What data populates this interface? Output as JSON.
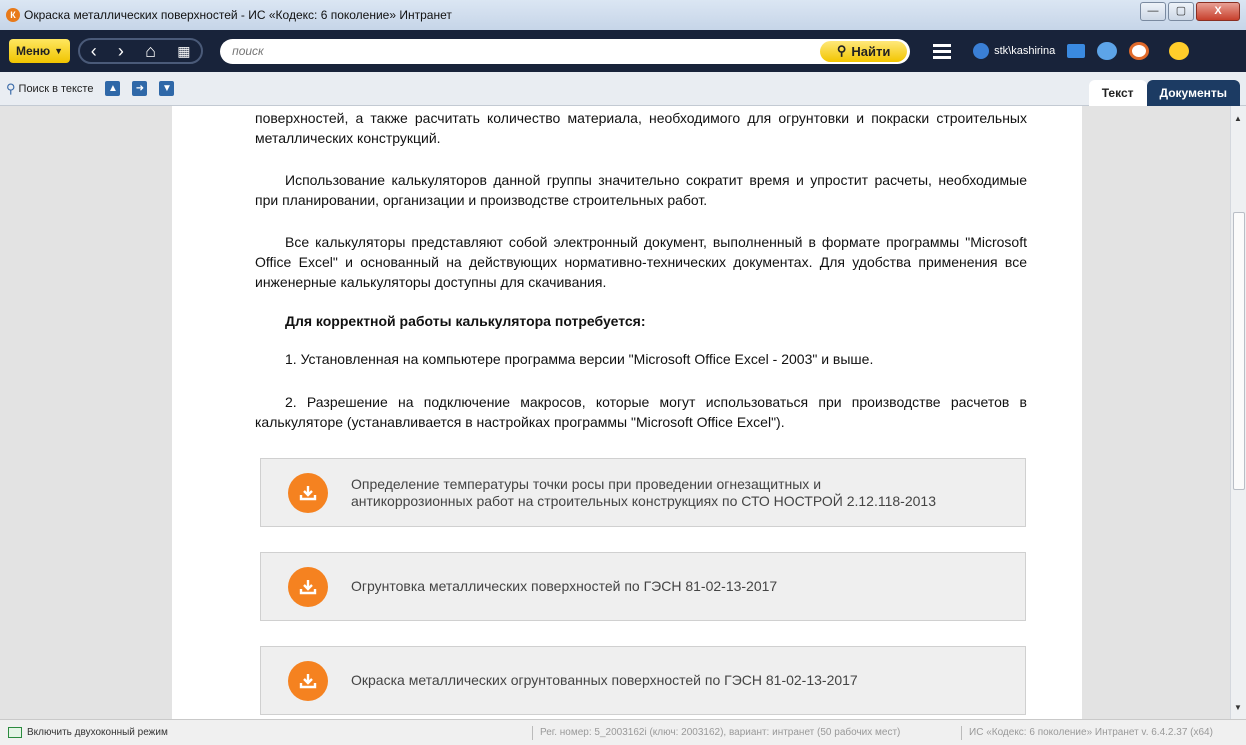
{
  "window": {
    "title": "Окраска металлических поверхностей - ИС «Кодекс: 6 поколение» Интранет",
    "controls": {
      "minimize": "—",
      "maximize": "▢",
      "close": "X"
    }
  },
  "toolbar": {
    "menu_label": "Меню",
    "search_placeholder": "поиск",
    "find_label": "Найти",
    "user": "stk\\kashirina"
  },
  "subbar": {
    "search_in_text": "Поиск в тексте",
    "tabs": [
      {
        "label": "Текст",
        "active": true
      },
      {
        "label": "Документы",
        "active": false
      }
    ]
  },
  "document": {
    "paragraphs": [
      "поверхностей, а также расчитать количество материала, необходимого для огрунтовки и покраски строительных металлических конструкций.",
      "Использование калькуляторов данной группы значительно сократит время и упростит расчеты, необходимые при планировании, организации и производстве строительных работ.",
      "Все калькуляторы представляют собой электронный документ, выполненный в формате программы \"Microsoft Office Excel\" и основанный на действующих нормативно-технических документах. Для удобства применения все инженерные калькуляторы доступны для скачивания.",
      "Для корректной работы калькулятора потребуется:",
      "1. Установленная на компьютере программа версии \"Microsoft Office Excel - 2003\" и выше.",
      "2. Разрешение на подключение макросов, которые могут использоваться при производстве расчетов в калькуляторе (устанавливается в настройках программы \"Microsoft Office Excel\")."
    ],
    "downloads": [
      {
        "line1": "Определение температуры точки росы при проведении огнезащитных и",
        "line2": "антикоррозионных работ на строительных конструкциях по СТО НОСТРОЙ 2.12.118-2013"
      },
      {
        "line1": "Огрунтовка металлических поверхностей по ГЭСН 81-02-13-2017",
        "line2": ""
      },
      {
        "line1": "Окраска металлических огрунтованных поверхностей по ГЭСН 81-02-13-2017",
        "line2": ""
      }
    ]
  },
  "status": {
    "two_window": "Включить двухоконный режим",
    "reg": "Рег. номер: 5_2003162i (ключ: 2003162), вариант: интранет (50 рабочих мест)",
    "version": "ИС «Кодекс: 6 поколение» Интранет v. 6.4.2.37 (x64)"
  },
  "colors": {
    "toolbar_bg": "#18233a",
    "accent_yellow": "#f2c500",
    "download_orange": "#f58220",
    "tab_dark": "#1c3b63"
  }
}
